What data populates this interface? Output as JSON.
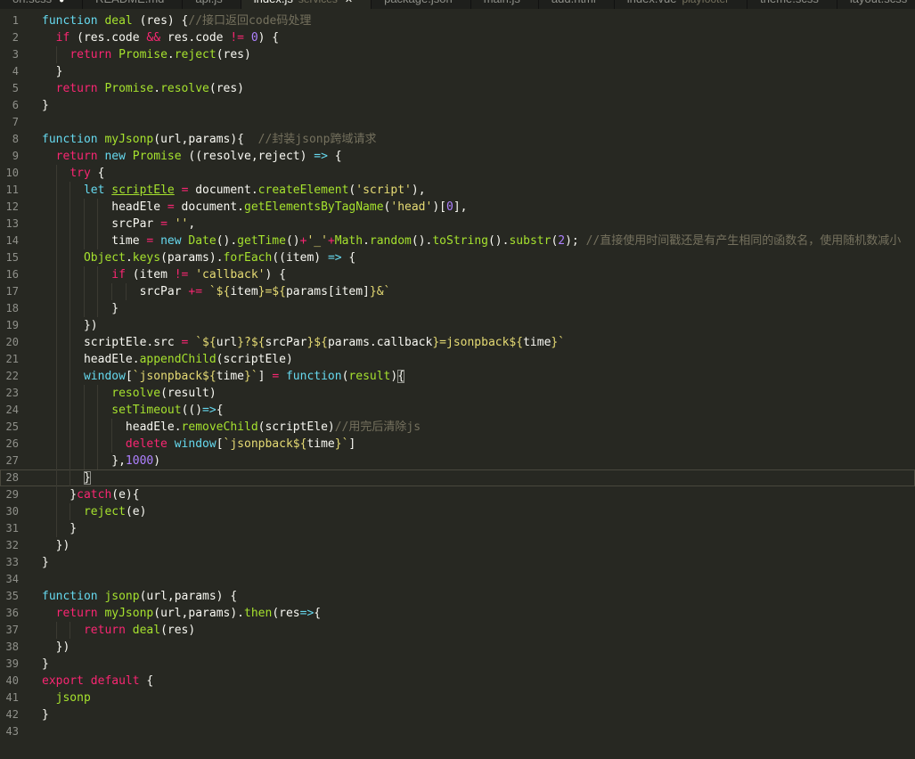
{
  "tabs": [
    {
      "label": "on.scss",
      "dot": "●",
      "active": false
    },
    {
      "label": "README.md",
      "active": false
    },
    {
      "label": "api.js",
      "active": false
    },
    {
      "label": "index.js",
      "desc": "services",
      "close": "✕",
      "active": true
    },
    {
      "label": "package.json",
      "active": false
    },
    {
      "label": "main.js",
      "active": false
    },
    {
      "label": "add.html",
      "active": false
    },
    {
      "label": "index.vue",
      "desc": "playfooter",
      "active": false
    },
    {
      "label": "theme.scss",
      "active": false
    },
    {
      "label": "layout.scss",
      "active": false
    }
  ],
  "colors": {
    "background": "#272822",
    "keyword": "#f92672",
    "storage": "#66d9ef",
    "function": "#a6e22e",
    "string": "#e6db74",
    "number": "#ae81ff",
    "comment": "#75715e",
    "text": "#f8f8f2",
    "gutter": "#8f908a"
  },
  "current_line": 28,
  "lines": [
    {
      "n": "1",
      "tokens": [
        [
          "st",
          "function"
        ],
        [
          "tx",
          " "
        ],
        [
          "fn",
          "deal"
        ],
        [
          "tx",
          " (res) {"
        ],
        [
          "cm",
          "//接口返回code码处理"
        ]
      ]
    },
    {
      "n": "2",
      "tokens": [
        [
          "tx",
          "  "
        ],
        [
          "kw",
          "if"
        ],
        [
          "tx",
          " (res.code "
        ],
        [
          "kw",
          "&&"
        ],
        [
          "tx",
          " res.code "
        ],
        [
          "kw",
          "!="
        ],
        [
          "tx",
          " "
        ],
        [
          "num",
          "0"
        ],
        [
          "tx",
          ") {"
        ]
      ]
    },
    {
      "n": "3",
      "tokens": [
        [
          "tx",
          "    "
        ],
        [
          "kw",
          "return"
        ],
        [
          "tx",
          " "
        ],
        [
          "fn",
          "Promise"
        ],
        [
          "tx",
          "."
        ],
        [
          "fn",
          "reject"
        ],
        [
          "tx",
          "(res)"
        ]
      ]
    },
    {
      "n": "4",
      "tokens": [
        [
          "tx",
          "  }"
        ]
      ]
    },
    {
      "n": "5",
      "tokens": [
        [
          "tx",
          "  "
        ],
        [
          "kw",
          "return"
        ],
        [
          "tx",
          " "
        ],
        [
          "fn",
          "Promise"
        ],
        [
          "tx",
          "."
        ],
        [
          "fn",
          "resolve"
        ],
        [
          "tx",
          "(res)"
        ]
      ]
    },
    {
      "n": "6",
      "tokens": [
        [
          "tx",
          "}"
        ]
      ]
    },
    {
      "n": "7",
      "tokens": []
    },
    {
      "n": "8",
      "tokens": [
        [
          "st",
          "function"
        ],
        [
          "tx",
          " "
        ],
        [
          "fn",
          "myJsonp"
        ],
        [
          "tx",
          "(url,params){  "
        ],
        [
          "cm",
          "//封装jsonp跨域请求"
        ]
      ]
    },
    {
      "n": "9",
      "tokens": [
        [
          "tx",
          "  "
        ],
        [
          "kw",
          "return"
        ],
        [
          "tx",
          " "
        ],
        [
          "st",
          "new"
        ],
        [
          "tx",
          " "
        ],
        [
          "fn",
          "Promise"
        ],
        [
          "tx",
          " ((resolve,reject) "
        ],
        [
          "st",
          "=>"
        ],
        [
          "tx",
          " {"
        ]
      ]
    },
    {
      "n": "10",
      "tokens": [
        [
          "tx",
          "    "
        ],
        [
          "kw",
          "try"
        ],
        [
          "tx",
          " {"
        ]
      ]
    },
    {
      "n": "11",
      "tokens": [
        [
          "tx",
          "      "
        ],
        [
          "st",
          "let"
        ],
        [
          "tx",
          " "
        ],
        [
          "ul",
          "scriptEle"
        ],
        [
          "tx",
          " "
        ],
        [
          "kw",
          "="
        ],
        [
          "tx",
          " document."
        ],
        [
          "fn",
          "createElement"
        ],
        [
          "tx",
          "("
        ],
        [
          "str",
          "'script'"
        ],
        [
          "tx",
          "),"
        ]
      ]
    },
    {
      "n": "12",
      "tokens": [
        [
          "tx",
          "          headEle "
        ],
        [
          "kw",
          "="
        ],
        [
          "tx",
          " document."
        ],
        [
          "fn",
          "getElementsByTagName"
        ],
        [
          "tx",
          "("
        ],
        [
          "str",
          "'head'"
        ],
        [
          "tx",
          ")["
        ],
        [
          "num",
          "0"
        ],
        [
          "tx",
          "],"
        ]
      ]
    },
    {
      "n": "13",
      "tokens": [
        [
          "tx",
          "          srcPar "
        ],
        [
          "kw",
          "="
        ],
        [
          "tx",
          " "
        ],
        [
          "str",
          "''"
        ],
        [
          "tx",
          ","
        ]
      ]
    },
    {
      "n": "14",
      "tokens": [
        [
          "tx",
          "          time "
        ],
        [
          "kw",
          "="
        ],
        [
          "tx",
          " "
        ],
        [
          "st",
          "new"
        ],
        [
          "tx",
          " "
        ],
        [
          "fn",
          "Date"
        ],
        [
          "tx",
          "()."
        ],
        [
          "fn",
          "getTime"
        ],
        [
          "tx",
          "()"
        ],
        [
          "kw",
          "+"
        ],
        [
          "str",
          "'_'"
        ],
        [
          "kw",
          "+"
        ],
        [
          "fn",
          "Math"
        ],
        [
          "tx",
          "."
        ],
        [
          "fn",
          "random"
        ],
        [
          "tx",
          "()."
        ],
        [
          "fn",
          "toString"
        ],
        [
          "tx",
          "()."
        ],
        [
          "fn",
          "substr"
        ],
        [
          "tx",
          "("
        ],
        [
          "num",
          "2"
        ],
        [
          "tx",
          "); "
        ],
        [
          "cm",
          "//直接使用时间戳还是有产生相同的函数名，使用随机数减小"
        ]
      ]
    },
    {
      "n": "15",
      "tokens": [
        [
          "tx",
          "      "
        ],
        [
          "fn",
          "Object"
        ],
        [
          "tx",
          "."
        ],
        [
          "fn",
          "keys"
        ],
        [
          "tx",
          "(params)."
        ],
        [
          "fn",
          "forEach"
        ],
        [
          "tx",
          "((item) "
        ],
        [
          "st",
          "=>"
        ],
        [
          "tx",
          " {"
        ]
      ]
    },
    {
      "n": "16",
      "tokens": [
        [
          "tx",
          "          "
        ],
        [
          "kw",
          "if"
        ],
        [
          "tx",
          " (item "
        ],
        [
          "kw",
          "!="
        ],
        [
          "tx",
          " "
        ],
        [
          "str",
          "'callback'"
        ],
        [
          "tx",
          ") {"
        ]
      ]
    },
    {
      "n": "17",
      "tokens": [
        [
          "tx",
          "              srcPar "
        ],
        [
          "kw",
          "+="
        ],
        [
          "tx",
          " "
        ],
        [
          "str",
          "`${"
        ],
        [
          "tx",
          "item"
        ],
        [
          "str",
          "}=${"
        ],
        [
          "tx",
          "params[item]"
        ],
        [
          "str",
          "}&`"
        ]
      ]
    },
    {
      "n": "18",
      "tokens": [
        [
          "tx",
          "          }"
        ]
      ]
    },
    {
      "n": "19",
      "tokens": [
        [
          "tx",
          "      })"
        ]
      ]
    },
    {
      "n": "20",
      "tokens": [
        [
          "tx",
          "      scriptEle.src "
        ],
        [
          "kw",
          "="
        ],
        [
          "tx",
          " "
        ],
        [
          "str",
          "`${"
        ],
        [
          "tx",
          "url"
        ],
        [
          "str",
          "}?${"
        ],
        [
          "tx",
          "srcPar"
        ],
        [
          "str",
          "}${"
        ],
        [
          "tx",
          "params.callback"
        ],
        [
          "str",
          "}=jsonpback${"
        ],
        [
          "tx",
          "time"
        ],
        [
          "str",
          "}`"
        ]
      ]
    },
    {
      "n": "21",
      "tokens": [
        [
          "tx",
          "      headEle."
        ],
        [
          "fn",
          "appendChild"
        ],
        [
          "tx",
          "(scriptEle)"
        ]
      ]
    },
    {
      "n": "22",
      "tokens": [
        [
          "tx",
          "      "
        ],
        [
          "st",
          "window"
        ],
        [
          "tx",
          "["
        ],
        [
          "str",
          "`jsonpback${"
        ],
        [
          "tx",
          "time"
        ],
        [
          "str",
          "}`"
        ],
        [
          "tx",
          "] "
        ],
        [
          "kw",
          "="
        ],
        [
          "tx",
          " "
        ],
        [
          "st",
          "function"
        ],
        [
          "tx",
          "("
        ],
        [
          "fn",
          "result"
        ],
        [
          "tx",
          ")"
        ],
        [
          "br",
          "{"
        ]
      ]
    },
    {
      "n": "23",
      "tokens": [
        [
          "tx",
          "          "
        ],
        [
          "fn",
          "resolve"
        ],
        [
          "tx",
          "(result)"
        ]
      ]
    },
    {
      "n": "24",
      "tokens": [
        [
          "tx",
          "          "
        ],
        [
          "fn",
          "setTimeout"
        ],
        [
          "tx",
          "(()"
        ],
        [
          "st",
          "=>"
        ],
        [
          "tx",
          "{"
        ]
      ]
    },
    {
      "n": "25",
      "tokens": [
        [
          "tx",
          "            headEle."
        ],
        [
          "fn",
          "removeChild"
        ],
        [
          "tx",
          "(scriptEle)"
        ],
        [
          "cm",
          "//用完后清除js"
        ]
      ]
    },
    {
      "n": "26",
      "tokens": [
        [
          "tx",
          "            "
        ],
        [
          "kw",
          "delete"
        ],
        [
          "tx",
          " "
        ],
        [
          "st",
          "window"
        ],
        [
          "tx",
          "["
        ],
        [
          "str",
          "`jsonpback${"
        ],
        [
          "tx",
          "time"
        ],
        [
          "str",
          "}`"
        ],
        [
          "tx",
          "]"
        ]
      ]
    },
    {
      "n": "27",
      "tokens": [
        [
          "tx",
          "          },"
        ],
        [
          "num",
          "1000"
        ],
        [
          "tx",
          ")"
        ]
      ]
    },
    {
      "n": "28",
      "tokens": [
        [
          "tx",
          "      "
        ],
        [
          "br",
          "}"
        ]
      ]
    },
    {
      "n": "29",
      "tokens": [
        [
          "tx",
          "    }"
        ],
        [
          "kw",
          "catch"
        ],
        [
          "tx",
          "(e){"
        ]
      ]
    },
    {
      "n": "30",
      "tokens": [
        [
          "tx",
          "      "
        ],
        [
          "fn",
          "reject"
        ],
        [
          "tx",
          "(e)"
        ]
      ]
    },
    {
      "n": "31",
      "tokens": [
        [
          "tx",
          "    }"
        ]
      ]
    },
    {
      "n": "32",
      "tokens": [
        [
          "tx",
          "  })"
        ]
      ]
    },
    {
      "n": "33",
      "tokens": [
        [
          "tx",
          "}"
        ]
      ]
    },
    {
      "n": "34",
      "tokens": []
    },
    {
      "n": "35",
      "tokens": [
        [
          "st",
          "function"
        ],
        [
          "tx",
          " "
        ],
        [
          "fn",
          "jsonp"
        ],
        [
          "tx",
          "(url,params) {"
        ]
      ]
    },
    {
      "n": "36",
      "tokens": [
        [
          "tx",
          "  "
        ],
        [
          "kw",
          "return"
        ],
        [
          "tx",
          " "
        ],
        [
          "fn",
          "myJsonp"
        ],
        [
          "tx",
          "(url,params)."
        ],
        [
          "fn",
          "then"
        ],
        [
          "tx",
          "(res"
        ],
        [
          "st",
          "=>"
        ],
        [
          "tx",
          "{"
        ]
      ]
    },
    {
      "n": "37",
      "tokens": [
        [
          "tx",
          "      "
        ],
        [
          "kw",
          "return"
        ],
        [
          "tx",
          " "
        ],
        [
          "fn",
          "deal"
        ],
        [
          "tx",
          "(res)"
        ]
      ]
    },
    {
      "n": "38",
      "tokens": [
        [
          "tx",
          "  })"
        ]
      ]
    },
    {
      "n": "39",
      "tokens": [
        [
          "tx",
          "}"
        ]
      ]
    },
    {
      "n": "40",
      "tokens": [
        [
          "kw",
          "export"
        ],
        [
          "tx",
          " "
        ],
        [
          "kw",
          "default"
        ],
        [
          "tx",
          " {"
        ]
      ]
    },
    {
      "n": "41",
      "tokens": [
        [
          "tx",
          "  "
        ],
        [
          "fn",
          "jsonp"
        ]
      ]
    },
    {
      "n": "42",
      "tokens": [
        [
          "tx",
          "}"
        ]
      ]
    },
    {
      "n": "43",
      "tokens": []
    }
  ]
}
